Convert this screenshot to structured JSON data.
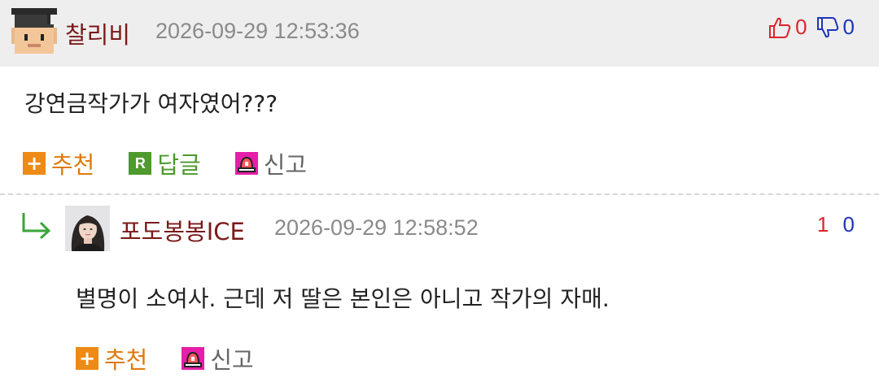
{
  "comments": [
    {
      "nickname": "찰리비",
      "date": "2026-09-29 12:53:36",
      "upvotes": "0",
      "downvotes": "0",
      "text": "강연금작가가 여자였어???",
      "actions": {
        "recommend": "추천",
        "reply": "답글",
        "report": "신고"
      }
    },
    {
      "nickname": "포도봉봉ICE",
      "date": "2026-09-29 12:58:52",
      "upvotes": "1",
      "downvotes": "0",
      "text": "별명이 소여사. 근데 저 딸은 본인은 아니고 작가의 자매.",
      "actions": {
        "recommend": "추천",
        "report": "신고"
      }
    }
  ],
  "icons": {
    "avatar1": "pixel-graduate-avatar-icon",
    "thumbs_up": "thumbs-up-icon",
    "thumbs_down": "thumbs-down-icon",
    "recommend": "plus-icon",
    "reply": "reply-r-icon",
    "report": "siren-icon",
    "reply_arrow": "reply-arrow-icon",
    "avatar2": "profile-photo"
  },
  "colors": {
    "nickname": "#7a1a1a",
    "upvote": "#d8262c",
    "downvote": "#1e35b8",
    "recommend": "#e07a0e",
    "reply": "#4e9a2c",
    "header_bg": "#eeeeee"
  }
}
